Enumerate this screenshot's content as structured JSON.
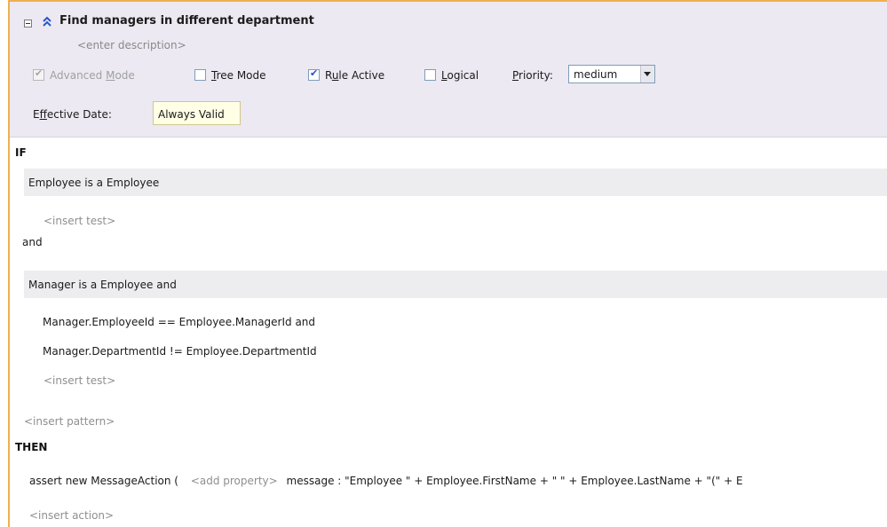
{
  "rule": {
    "title": "Find managers in different department",
    "description_placeholder": "<enter description>",
    "advanced_mode": {
      "prefix": "Advanced ",
      "mnemonic": "M",
      "suffix": "ode",
      "checked": true,
      "enabled": false
    },
    "tree_mode": {
      "mnemonic": "T",
      "suffix": "ree Mode",
      "checked": false
    },
    "rule_active": {
      "prefix": "R",
      "mnemonic": "u",
      "suffix": "le Active",
      "checked": true
    },
    "logical": {
      "mnemonic": "L",
      "suffix": "ogical",
      "checked": false
    },
    "priority": {
      "mnemonic": "P",
      "suffix": "riority:",
      "value": "medium"
    },
    "effective_date": {
      "prefix": "E",
      "mnemonic": "f",
      "suffix": "fective Date:",
      "value": "Always Valid"
    }
  },
  "if_section": {
    "keyword": "IF",
    "pattern1": {
      "header": "Employee is a Employee",
      "insert_test": "<insert test>"
    },
    "connector": "and",
    "pattern2": {
      "header": "Manager is a Employee  and",
      "tests": [
        "Manager.EmployeeId  ==  Employee.ManagerId and",
        "Manager.DepartmentId  !=  Employee.DepartmentId"
      ],
      "insert_test": "<insert test>"
    },
    "insert_pattern": "<insert pattern>"
  },
  "then_section": {
    "keyword": "THEN",
    "action_prefix": "assert new MessageAction (",
    "add_property": "<add property>",
    "action_rest": "message : \"Employee \" +  Employee.FirstName + \" \" + Employee.LastName + \"(\" + E",
    "insert_action": "<insert action>"
  },
  "colors": {
    "header_bg": "#ece9f2",
    "pattern_bg": "#edecef",
    "frame_accent": "#f0b050",
    "checkbox_check": "#2a4fbf"
  }
}
